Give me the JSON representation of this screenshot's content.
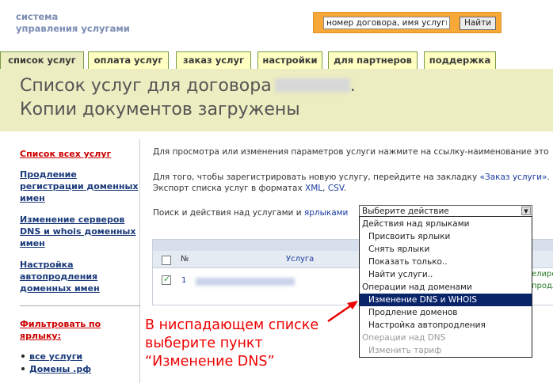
{
  "header": {
    "logo_line1": "система",
    "logo_line2": "управления услугами",
    "search_value": "номер договора, имя услуги",
    "search_button": "Найти"
  },
  "tabs": [
    {
      "label": "список услуг",
      "active": true
    },
    {
      "label": "оплата услуг",
      "active": false
    },
    {
      "label": "заказ услуг",
      "active": false
    },
    {
      "label": "настройки",
      "active": false
    },
    {
      "label": "для партнеров",
      "active": false
    },
    {
      "label": "поддержка",
      "active": false
    }
  ],
  "title": {
    "line1": "Список услуг для договора",
    "line1_end": ".",
    "line2": "Копии документов загружены"
  },
  "sidebar": {
    "items": [
      {
        "label": "Список всех услуг",
        "color": "red"
      },
      {
        "label": "Продление регистрации доменных имен"
      },
      {
        "label": "Изменение серверов DNS и whois доменных имен"
      },
      {
        "label": "Настройка автопродления доменных имен"
      }
    ],
    "filter_label": "Фильтровать по ярлыку:",
    "filter_items": [
      "все услуги",
      "Домены .рф"
    ]
  },
  "main": {
    "intro": "Для просмотра или изменения параметров услуги нажмите на ссылку-наименование это",
    "register_prefix": "Для того, чтобы зарегистрировать новую услугу, перейдите на закладку",
    "register_link": "«Заказ услуги»",
    "register_suffix": ".",
    "export_prefix": "Экспорт списка услуг в форматах",
    "export_xml": "XML",
    "export_sep": ",",
    "export_csv": "CSV",
    "export_suffix": ".",
    "search_actions_prefix": "Поиск и действия над услугами и",
    "labels_link": "ярлыками",
    "table": {
      "col_num": "№",
      "col_service": "Услуга",
      "row_num": "1",
      "partial_right1": "елиро",
      "partial_right2": "продл"
    }
  },
  "dropdown": {
    "selected": "Выберите действие",
    "options": [
      {
        "label": "Действия над ярлыками",
        "type": "group"
      },
      {
        "label": "Присвоить ярлыки",
        "type": "item"
      },
      {
        "label": "Снять ярлыки",
        "type": "item"
      },
      {
        "label": "Показать только..",
        "type": "item"
      },
      {
        "label": "Найти услуги..",
        "type": "item"
      },
      {
        "label": "Операции над доменами",
        "type": "group"
      },
      {
        "label": "Изменение DNS и WHOIS",
        "type": "selected"
      },
      {
        "label": "Продление доменов",
        "type": "item"
      },
      {
        "label": "Настройка автопродления",
        "type": "item"
      },
      {
        "label": "Операции над DNS",
        "type": "disabled-group"
      },
      {
        "label": "Изменить тариф",
        "type": "disabled"
      }
    ]
  },
  "annotation": {
    "line1": "В ниспадающем списке",
    "line2": "выберите пункт",
    "line3": "“Изменение DNS”"
  },
  "colors": {
    "tab_bg": "#ffffc2",
    "title_band": "#ecedc0",
    "search_bg": "#f7a836",
    "annotation": "#e00000",
    "selected_option": "#0a246a"
  }
}
